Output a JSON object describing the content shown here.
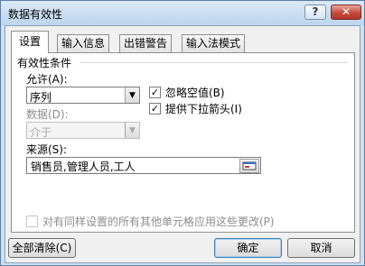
{
  "window": {
    "title": "数据有效性",
    "help_label": "?",
    "close_label": "✕"
  },
  "tabs": [
    {
      "label": "设置",
      "active": true
    },
    {
      "label": "输入信息",
      "active": false
    },
    {
      "label": "出错警告",
      "active": false
    },
    {
      "label": "输入法模式",
      "active": false
    }
  ],
  "settings": {
    "section_title": "有效性条件",
    "allow_label": "允许(A):",
    "allow_value": "序列",
    "ignore_blank": {
      "label": "忽略空值(B)",
      "checked": true
    },
    "dropdown_arrow": {
      "label": "提供下拉箭头(I)",
      "checked": true
    },
    "data_label": "数据(D):",
    "data_value": "介于",
    "source_label": "来源(S):",
    "source_value": "销售员,管理人员,工人",
    "apply_all": {
      "label": "对有同样设置的所有其他单元格应用这些更改(P)",
      "checked": false
    }
  },
  "buttons": {
    "clear_all": "全部清除(C)",
    "ok": "确定",
    "cancel": "取消"
  },
  "icons": {
    "dropdown": "triangle-down",
    "checkmark": "check",
    "range_picker": "collapse-dialog-icon"
  },
  "colors": {
    "title_bar": "#c4d9ee",
    "close_button": "#c24a3b",
    "default_button_border": "#3c7fb1"
  }
}
